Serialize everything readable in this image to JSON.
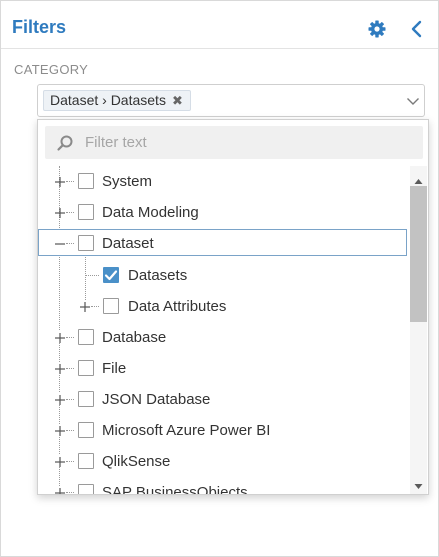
{
  "header": {
    "title": "Filters"
  },
  "category": {
    "label": "CATEGORY",
    "selected_tag": "Dataset › Datasets",
    "remove_symbol": "✖"
  },
  "filter": {
    "placeholder": "Filter text"
  },
  "tree": {
    "items": [
      {
        "label": "System",
        "checked": false,
        "expander": "plus"
      },
      {
        "label": "Data Modeling",
        "checked": false,
        "expander": "plus"
      },
      {
        "label": "Dataset",
        "checked": false,
        "expander": "minus",
        "selected": true
      },
      {
        "label": "Datasets",
        "checked": true,
        "expander": "none"
      },
      {
        "label": "Data Attributes",
        "checked": false,
        "expander": "plus"
      },
      {
        "label": "Database",
        "checked": false,
        "expander": "plus"
      },
      {
        "label": "File",
        "checked": false,
        "expander": "plus"
      },
      {
        "label": "JSON Database",
        "checked": false,
        "expander": "plus"
      },
      {
        "label": "Microsoft Azure Power BI",
        "checked": false,
        "expander": "plus"
      },
      {
        "label": "QlikSense",
        "checked": false,
        "expander": "plus"
      },
      {
        "label": "SAP BusinessObjects",
        "checked": false,
        "expander": "plus"
      }
    ]
  },
  "colors": {
    "accent": "#2f7bbf",
    "checkbox_checked": "#4a90c8"
  },
  "icons": {
    "settings": "gear-icon",
    "back": "chevron-left-icon",
    "dropdown": "chevron-down-icon",
    "search": "search-icon"
  }
}
